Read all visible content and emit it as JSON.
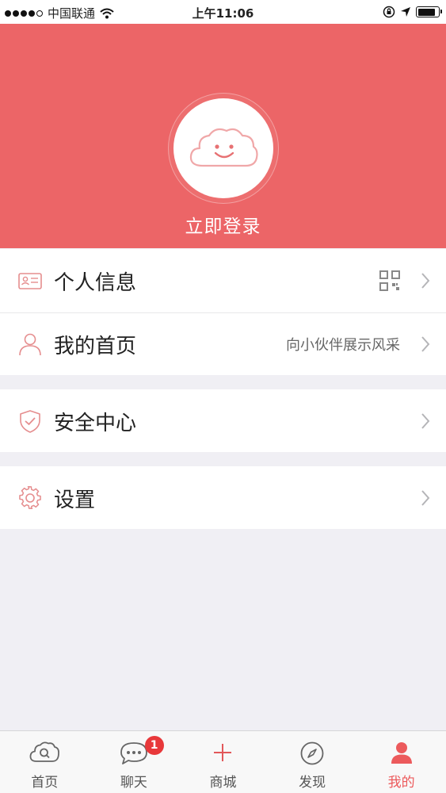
{
  "status_bar": {
    "carrier": "中国联通",
    "time": "上午11:06",
    "signal_dots_filled": 4,
    "signal_dots_total": 5,
    "battery_level": 0.85
  },
  "header": {
    "login_label": "立即登录",
    "background_color": "#ec6567"
  },
  "menu": {
    "profile": {
      "label": "个人信息",
      "icon": "id-card-icon",
      "trailing_icon": "qr-code-icon"
    },
    "homepage": {
      "label": "我的首页",
      "icon": "user-icon",
      "sub": "向小伙伴展示风采"
    },
    "security": {
      "label": "安全中心",
      "icon": "shield-check-icon"
    },
    "settings": {
      "label": "设置",
      "icon": "gear-icon"
    }
  },
  "tabbar": {
    "tabs": [
      {
        "label": "首页",
        "icon": "cloud-search-icon",
        "active": false
      },
      {
        "label": "聊天",
        "icon": "chat-bubble-icon",
        "active": false,
        "badge": "1"
      },
      {
        "label": "商城",
        "icon": "plus-icon",
        "active": false
      },
      {
        "label": "发现",
        "icon": "compass-icon",
        "active": false
      },
      {
        "label": "我的",
        "icon": "person-icon",
        "active": true
      }
    ],
    "active_color": "#ec5a5c"
  }
}
